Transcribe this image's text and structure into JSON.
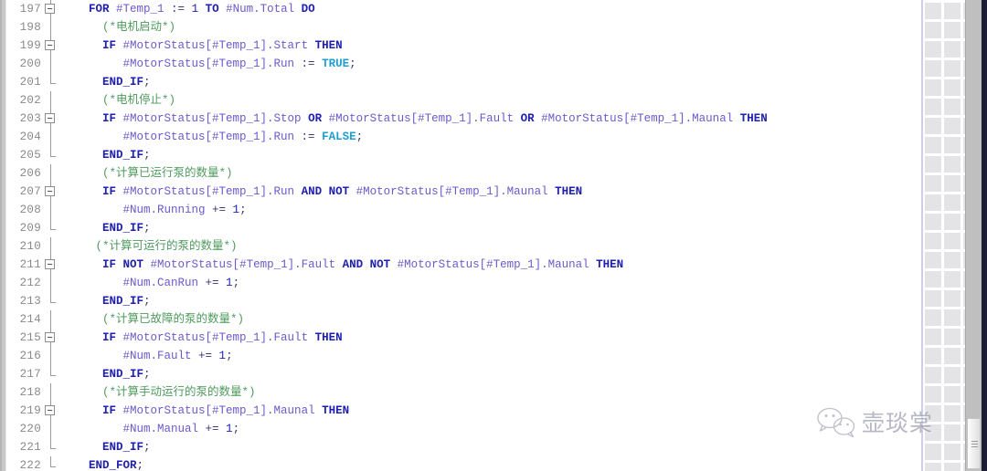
{
  "app": {
    "name": "TIA Portal SCL Code Editor",
    "language": "SCL"
  },
  "editor": {
    "first_visible_line": 197,
    "last_visible_line": 222,
    "line_height_px": 20,
    "colors": {
      "keyword": "#2020b0",
      "variable": "#6a5acd",
      "literal": "#1f9fd0",
      "comment": "#4f9a5e",
      "line_number": "#8a8a8a",
      "background": "#ffffff"
    },
    "lines": [
      {
        "number": "197",
        "fold": "open",
        "indent": 4,
        "tokens": [
          {
            "t": "FOR ",
            "c": "kw"
          },
          {
            "t": "#Temp_1",
            "c": "var"
          },
          {
            "t": " := ",
            "c": "pun"
          },
          {
            "t": "1",
            "c": "num"
          },
          {
            "t": " TO ",
            "c": "kw"
          },
          {
            "t": "#Num.Total",
            "c": "var"
          },
          {
            "t": " DO",
            "c": "kw"
          }
        ]
      },
      {
        "number": "198",
        "fold": "line",
        "indent": 6,
        "tokens": [
          {
            "t": "(*电机启动*)",
            "c": "cmt"
          }
        ]
      },
      {
        "number": "199",
        "fold": "open",
        "indent": 6,
        "tokens": [
          {
            "t": "IF ",
            "c": "kw"
          },
          {
            "t": "#MotorStatus[#Temp_1].Start",
            "c": "var"
          },
          {
            "t": " THEN",
            "c": "kw"
          }
        ]
      },
      {
        "number": "200",
        "fold": "line",
        "indent": 9,
        "tokens": [
          {
            "t": "#MotorStatus[#Temp_1].Run",
            "c": "var"
          },
          {
            "t": " := ",
            "c": "pun"
          },
          {
            "t": "TRUE",
            "c": "lit"
          },
          {
            "t": ";",
            "c": "pun"
          }
        ]
      },
      {
        "number": "201",
        "fold": "end",
        "indent": 6,
        "tokens": [
          {
            "t": "END_IF",
            "c": "kw"
          },
          {
            "t": ";",
            "c": "pun"
          }
        ]
      },
      {
        "number": "202",
        "fold": "line",
        "indent": 6,
        "tokens": [
          {
            "t": "(*电机停止*)",
            "c": "cmt"
          }
        ]
      },
      {
        "number": "203",
        "fold": "open",
        "indent": 6,
        "tokens": [
          {
            "t": "IF ",
            "c": "kw"
          },
          {
            "t": "#MotorStatus[#Temp_1].Stop",
            "c": "var"
          },
          {
            "t": " OR ",
            "c": "op"
          },
          {
            "t": "#MotorStatus[#Temp_1].Fault",
            "c": "var"
          },
          {
            "t": " OR ",
            "c": "op"
          },
          {
            "t": "#MotorStatus[#Temp_1].Maunal",
            "c": "var"
          },
          {
            "t": " THEN",
            "c": "kw"
          }
        ]
      },
      {
        "number": "204",
        "fold": "line",
        "indent": 9,
        "tokens": [
          {
            "t": "#MotorStatus[#Temp_1].Run",
            "c": "var"
          },
          {
            "t": " := ",
            "c": "pun"
          },
          {
            "t": "FALSE",
            "c": "lit"
          },
          {
            "t": ";",
            "c": "pun"
          }
        ]
      },
      {
        "number": "205",
        "fold": "end",
        "indent": 6,
        "tokens": [
          {
            "t": "END_IF",
            "c": "kw"
          },
          {
            "t": ";",
            "c": "pun"
          }
        ]
      },
      {
        "number": "206",
        "fold": "line",
        "indent": 6,
        "tokens": [
          {
            "t": "(*计算已运行泵的数量*)",
            "c": "cmt"
          }
        ]
      },
      {
        "number": "207",
        "fold": "open",
        "indent": 6,
        "tokens": [
          {
            "t": "IF ",
            "c": "kw"
          },
          {
            "t": "#MotorStatus[#Temp_1].Run",
            "c": "var"
          },
          {
            "t": " AND ",
            "c": "op"
          },
          {
            "t": "NOT ",
            "c": "op"
          },
          {
            "t": "#MotorStatus[#Temp_1].Maunal",
            "c": "var"
          },
          {
            "t": " THEN",
            "c": "kw"
          }
        ]
      },
      {
        "number": "208",
        "fold": "line",
        "indent": 9,
        "tokens": [
          {
            "t": "#Num.Running",
            "c": "var"
          },
          {
            "t": " += ",
            "c": "pun"
          },
          {
            "t": "1",
            "c": "num"
          },
          {
            "t": ";",
            "c": "pun"
          }
        ]
      },
      {
        "number": "209",
        "fold": "end",
        "indent": 6,
        "tokens": [
          {
            "t": "END_IF",
            "c": "kw"
          },
          {
            "t": ";",
            "c": "pun"
          }
        ]
      },
      {
        "number": "210",
        "fold": "line",
        "indent": 5,
        "tokens": [
          {
            "t": "(*计算可运行的泵的数量*)",
            "c": "cmt"
          }
        ]
      },
      {
        "number": "211",
        "fold": "open",
        "indent": 6,
        "tokens": [
          {
            "t": "IF ",
            "c": "kw"
          },
          {
            "t": "NOT ",
            "c": "op"
          },
          {
            "t": "#MotorStatus[#Temp_1].Fault",
            "c": "var"
          },
          {
            "t": " AND ",
            "c": "op"
          },
          {
            "t": "NOT ",
            "c": "op"
          },
          {
            "t": "#MotorStatus[#Temp_1].Maunal",
            "c": "var"
          },
          {
            "t": " THEN",
            "c": "kw"
          }
        ]
      },
      {
        "number": "212",
        "fold": "line",
        "indent": 9,
        "tokens": [
          {
            "t": "#Num.CanRun",
            "c": "var"
          },
          {
            "t": " += ",
            "c": "pun"
          },
          {
            "t": "1",
            "c": "num"
          },
          {
            "t": ";",
            "c": "pun"
          }
        ]
      },
      {
        "number": "213",
        "fold": "end",
        "indent": 6,
        "tokens": [
          {
            "t": "END_IF",
            "c": "kw"
          },
          {
            "t": ";",
            "c": "pun"
          }
        ]
      },
      {
        "number": "214",
        "fold": "line",
        "indent": 6,
        "tokens": [
          {
            "t": "(*计算已故障的泵的数量*)",
            "c": "cmt"
          }
        ]
      },
      {
        "number": "215",
        "fold": "open",
        "indent": 6,
        "tokens": [
          {
            "t": "IF ",
            "c": "kw"
          },
          {
            "t": "#MotorStatus[#Temp_1].Fault",
            "c": "var"
          },
          {
            "t": " THEN",
            "c": "kw"
          }
        ]
      },
      {
        "number": "216",
        "fold": "line",
        "indent": 9,
        "tokens": [
          {
            "t": "#Num.Fault",
            "c": "var"
          },
          {
            "t": " += ",
            "c": "pun"
          },
          {
            "t": "1",
            "c": "num"
          },
          {
            "t": ";",
            "c": "pun"
          }
        ]
      },
      {
        "number": "217",
        "fold": "end",
        "indent": 6,
        "tokens": [
          {
            "t": "END_IF",
            "c": "kw"
          },
          {
            "t": ";",
            "c": "pun"
          }
        ]
      },
      {
        "number": "218",
        "fold": "line",
        "indent": 6,
        "tokens": [
          {
            "t": "(*计算手动运行的泵的数量*)",
            "c": "cmt"
          }
        ]
      },
      {
        "number": "219",
        "fold": "open",
        "indent": 6,
        "tokens": [
          {
            "t": "IF ",
            "c": "kw"
          },
          {
            "t": "#MotorStatus[#Temp_1].Maunal",
            "c": "var"
          },
          {
            "t": " THEN",
            "c": "kw"
          }
        ]
      },
      {
        "number": "220",
        "fold": "line",
        "indent": 9,
        "tokens": [
          {
            "t": "#Num.Manual",
            "c": "var"
          },
          {
            "t": " += ",
            "c": "pun"
          },
          {
            "t": "1",
            "c": "num"
          },
          {
            "t": ";",
            "c": "pun"
          }
        ]
      },
      {
        "number": "221",
        "fold": "end",
        "indent": 6,
        "tokens": [
          {
            "t": "END_IF",
            "c": "kw"
          },
          {
            "t": ";",
            "c": "pun"
          }
        ]
      },
      {
        "number": "222",
        "fold": "end",
        "indent": 4,
        "tokens": [
          {
            "t": "END_FOR",
            "c": "kw"
          },
          {
            "t": ";",
            "c": "pun"
          }
        ]
      }
    ]
  },
  "watermark": {
    "text": "壶琰棠",
    "icon": "wechat-icon"
  },
  "scrollbar": {
    "orientation": "vertical",
    "thumb_position": "bottom"
  }
}
